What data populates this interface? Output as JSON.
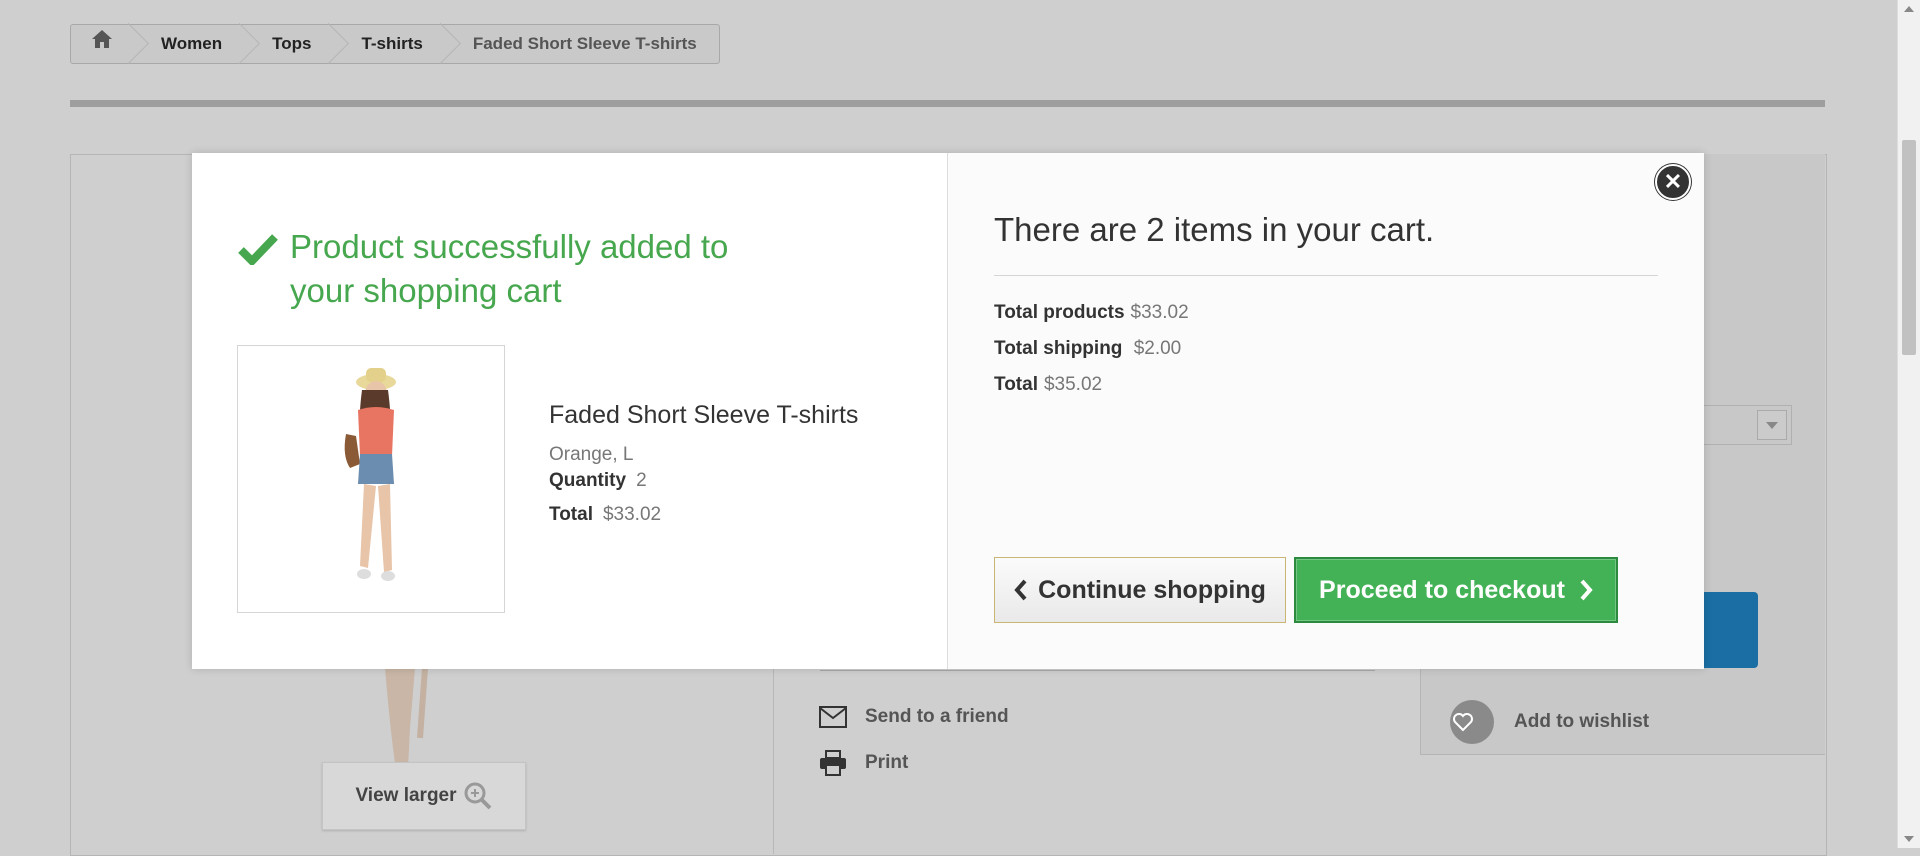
{
  "breadcrumb": {
    "home_icon": "home-icon",
    "items": [
      "Women",
      "Tops",
      "T-shirts",
      "Faded Short Sleeve T-shirts"
    ]
  },
  "background": {
    "send_to_friend": "Send to a friend",
    "print": "Print",
    "add_to_wishlist": "Add to wishlist",
    "view_larger": "View larger"
  },
  "modal": {
    "success_message": "Product successfully added to your shopping cart",
    "product": {
      "name": "Faded Short Sleeve T-shirts",
      "attributes": "Orange, L",
      "quantity_label": "Quantity",
      "quantity": "2",
      "total_label": "Total",
      "total": "$33.02"
    },
    "cart": {
      "title": "There are 2 items in your cart.",
      "total_products_label": "Total products",
      "total_products": "$33.02",
      "total_shipping_label": "Total shipping",
      "total_shipping": "$2.00",
      "total_label": "Total",
      "total": "$35.02"
    },
    "continue_label": "Continue shopping",
    "checkout_label": "Proceed to checkout"
  },
  "colors": {
    "success_green": "#46a74e",
    "checkout_green": "#43b155",
    "overlay_gray": "#cfcfcf"
  }
}
